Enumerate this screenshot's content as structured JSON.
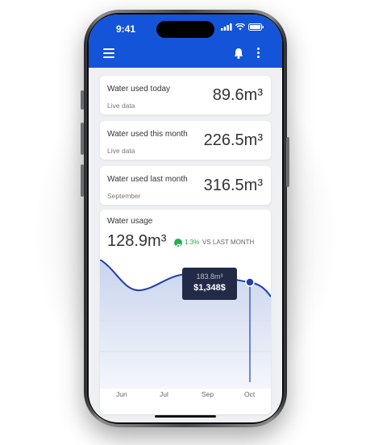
{
  "status_bar": {
    "time": "9:41"
  },
  "header": {
    "menu_icon": "menu-icon",
    "bell_icon": "bell-icon",
    "more_icon": "more-vertical-icon",
    "color": "#1454d9"
  },
  "cards": [
    {
      "title": "Water used today",
      "subtitle": "Live data",
      "value": "89.6m³"
    },
    {
      "title": "Water used this month",
      "subtitle": "Live data",
      "value": "226.5m³"
    },
    {
      "title": "Water used last month",
      "subtitle": "September",
      "value": "316.5m³"
    }
  ],
  "usage": {
    "title": "Water usage",
    "value": "128.9m³",
    "trend_percent": "1.3%",
    "trend_label": "VS LAST MONTH",
    "trend_color": "#22b14c"
  },
  "tooltip": {
    "volume": "183.8m³",
    "cost": "$1,348$"
  },
  "chart_data": {
    "type": "line",
    "categories": [
      "Jun",
      "Jul",
      "Sep",
      "Oct"
    ],
    "series_color": "#1f3fb0",
    "grid": true
  }
}
